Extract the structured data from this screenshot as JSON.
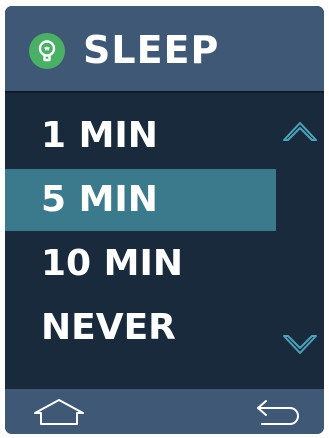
{
  "header": {
    "title": "SLEEP",
    "icon": "sleep-settings-icon",
    "icon_color": "#49b066"
  },
  "options": [
    {
      "label": "1 MIN",
      "selected": false
    },
    {
      "label": "5 MIN",
      "selected": true
    },
    {
      "label": "10 MIN",
      "selected": false
    },
    {
      "label": "NEVER",
      "selected": false
    }
  ],
  "scroll": {
    "up_icon": "chevron-up-icon",
    "down_icon": "chevron-down-icon"
  },
  "footer": {
    "home_icon": "home-icon",
    "back_icon": "back-icon"
  },
  "colors": {
    "background": "#1a2a3d",
    "bar": "#3e5875",
    "selected": "#3b7a8c",
    "accent": "#4aa3b8"
  }
}
